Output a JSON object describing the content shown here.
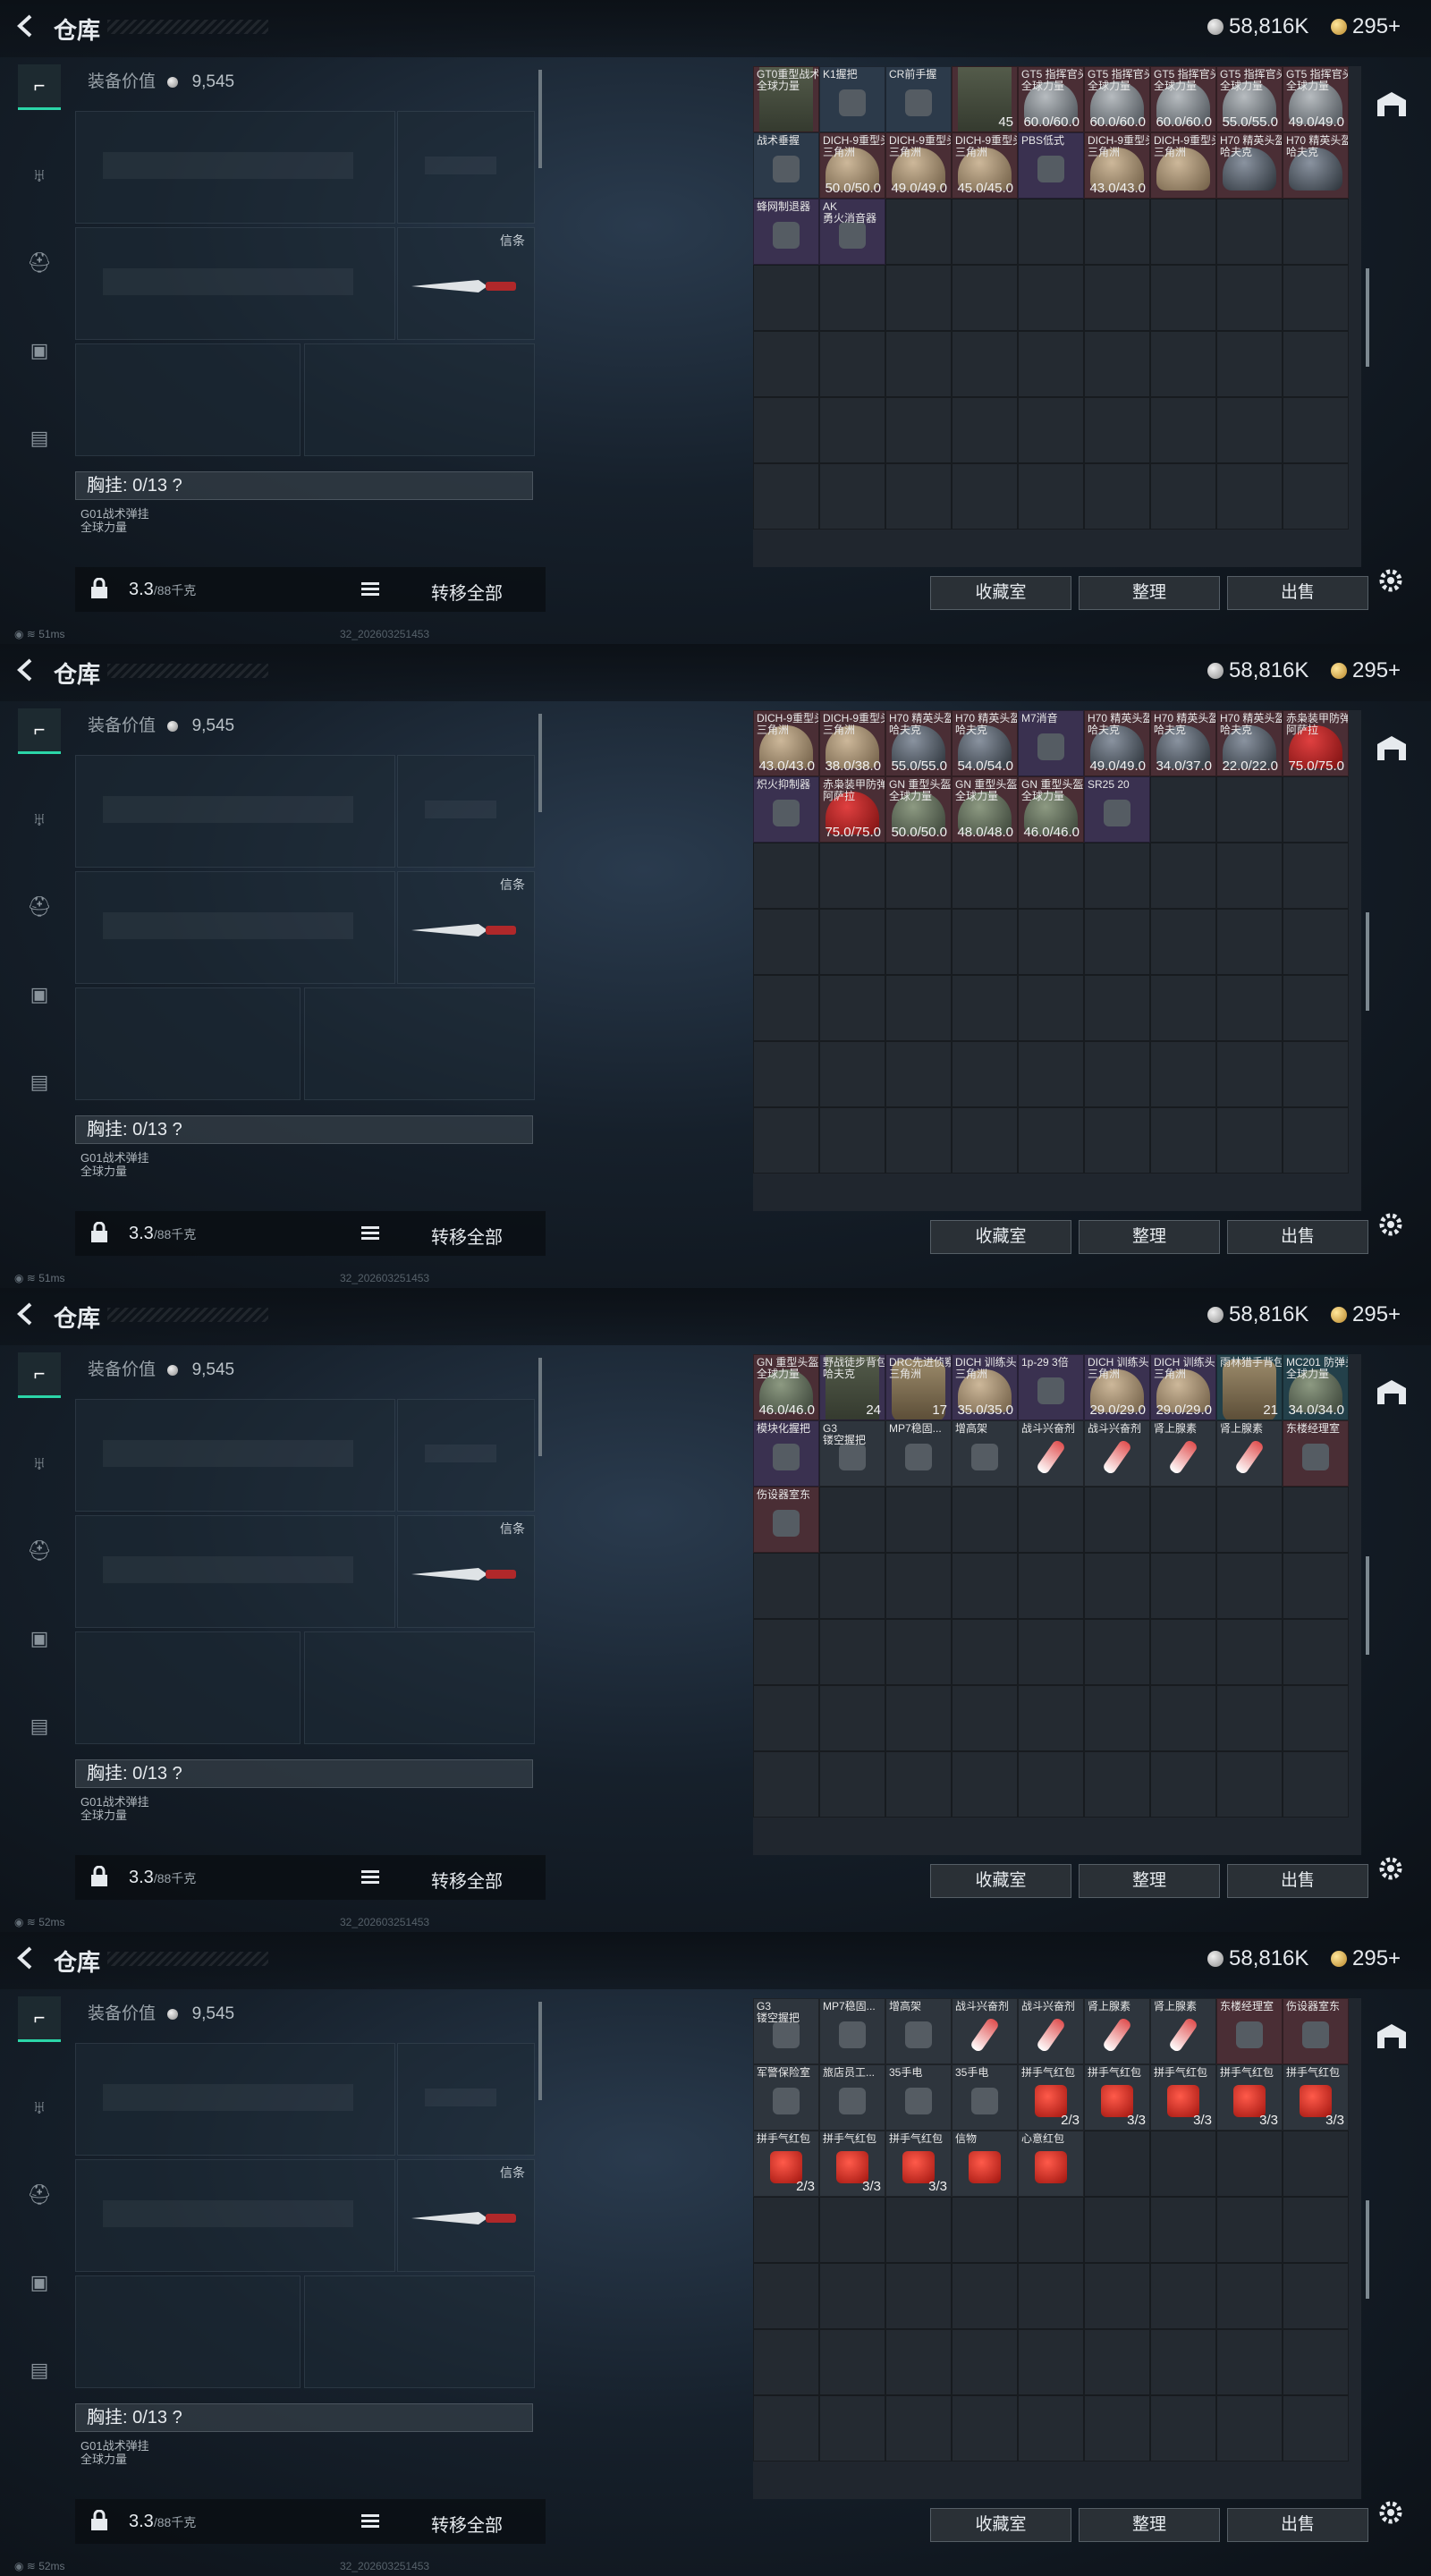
{
  "header": {
    "title": "仓库",
    "silver": "58,816K",
    "gold": "295+"
  },
  "loadout": {
    "equip_value_label": "装备价值",
    "equip_value": "9,545",
    "knife_label": "信条",
    "chest_label": "胸挂: 0/13 ?",
    "chest_item_line1": "G01战术弹挂",
    "chest_item_line2": "全球力量",
    "weight": "3.3",
    "weight_max": "/88千克",
    "transfer_label": "转移全部"
  },
  "stash_buttons": {
    "collection": "收藏室",
    "sort": "整理",
    "sell": "出售"
  },
  "status": [
    {
      "ping": "51ms",
      "build": "32_202603251453"
    },
    {
      "ping": "51ms",
      "build": "32_202603251453"
    },
    {
      "ping": "52ms",
      "build": "32_202603251453"
    },
    {
      "ping": "52ms",
      "build": "32_202603251453"
    }
  ],
  "panel1": [
    {
      "name": "GT0重型战术背",
      "sub": "全球力量",
      "val": "",
      "kind": "vest",
      "bg": "c-red"
    },
    {
      "name": "K1握把",
      "sub": "",
      "val": "",
      "kind": "small",
      "bg": "c-blue"
    },
    {
      "name": "CR前手握",
      "sub": "",
      "val": "",
      "kind": "small",
      "bg": "c-blue"
    },
    {
      "name": "",
      "sub": "",
      "val": "45",
      "kind": "vest",
      "bg": "c-red"
    },
    {
      "name": "GT5 指挥官头盔",
      "sub": "全球力量",
      "val": "60.0/60.0",
      "kind": "gray",
      "bg": "c-red"
    },
    {
      "name": "GT5 指挥官头盔",
      "sub": "全球力量",
      "val": "60.0/60.0",
      "kind": "gray",
      "bg": "c-red"
    },
    {
      "name": "GT5 指挥官头盔",
      "sub": "全球力量",
      "val": "60.0/60.0",
      "kind": "gray",
      "bg": "c-red"
    },
    {
      "name": "GT5 指挥官头盔",
      "sub": "全球力量",
      "val": "55.0/55.0",
      "kind": "gray",
      "bg": "c-red"
    },
    {
      "name": "GT5 指挥官头盔",
      "sub": "全球力量",
      "val": "49.0/49.0",
      "kind": "gray",
      "bg": "c-red"
    },
    {
      "name": "战术垂握",
      "sub": "",
      "val": "",
      "kind": "small",
      "bg": "c-blue"
    },
    {
      "name": "DICH-9重型头盔",
      "sub": "三角洲",
      "val": "50.0/50.0",
      "kind": "sand",
      "bg": "c-red"
    },
    {
      "name": "DICH-9重型头盔",
      "sub": "三角洲",
      "val": "49.0/49.0",
      "kind": "sand",
      "bg": "c-red"
    },
    {
      "name": "DICH-9重型头盔",
      "sub": "三角洲",
      "val": "45.0/45.0",
      "kind": "sand",
      "bg": "c-red"
    },
    {
      "name": "PBS低式",
      "sub": "",
      "val": "",
      "kind": "small",
      "bg": "c-purple"
    },
    {
      "name": "DICH-9重型头盔",
      "sub": "三角洲",
      "val": "43.0/43.0",
      "kind": "sand",
      "bg": "c-red"
    },
    {
      "name": "DICH-9重型头盔",
      "sub": "三角洲",
      "val": "",
      "kind": "sand",
      "bg": "c-red"
    },
    {
      "name": "H70 精英头盔",
      "sub": "哈夫克",
      "val": "",
      "kind": "dark",
      "bg": "c-red"
    },
    {
      "name": "H70 精英头盔",
      "sub": "哈夫克",
      "val": "",
      "kind": "dark",
      "bg": "c-red"
    },
    {
      "name": "蜂网制退器",
      "sub": "",
      "val": "",
      "kind": "small",
      "bg": "c-purple"
    },
    {
      "name": "AK",
      "sub": "勇火消音器",
      "val": "",
      "kind": "small",
      "bg": "c-purple"
    }
  ],
  "panel2": [
    {
      "name": "DICH-9重型头盔",
      "sub": "三角洲",
      "val": "43.0/43.0",
      "kind": "sand",
      "bg": "c-red"
    },
    {
      "name": "DICH-9重型头盔",
      "sub": "三角洲",
      "val": "38.0/38.0",
      "kind": "sand",
      "bg": "c-red"
    },
    {
      "name": "H70 精英头盔",
      "sub": "哈夫克",
      "val": "55.0/55.0",
      "kind": "dark",
      "bg": "c-red"
    },
    {
      "name": "H70 精英头盔",
      "sub": "哈夫克",
      "val": "54.0/54.0",
      "kind": "dark",
      "bg": "c-red"
    },
    {
      "name": "M7消音",
      "sub": "",
      "val": "",
      "kind": "small",
      "bg": "c-purple"
    },
    {
      "name": "H70 精英头盔",
      "sub": "哈夫克",
      "val": "49.0/49.0",
      "kind": "dark",
      "bg": "c-red"
    },
    {
      "name": "H70 精英头盔",
      "sub": "哈夫克",
      "val": "34.0/37.0",
      "kind": "dark",
      "bg": "c-red"
    },
    {
      "name": "H70 精英头盔",
      "sub": "哈夫克",
      "val": "22.0/22.0",
      "kind": "dark",
      "bg": "c-red"
    },
    {
      "name": "赤枭装甲防弹面具",
      "sub": "阿萨拉",
      "val": "75.0/75.0",
      "kind": "red",
      "bg": "c-red"
    },
    {
      "name": "炽火抑制器",
      "sub": "",
      "val": "",
      "kind": "small",
      "bg": "c-purple"
    },
    {
      "name": "赤枭装甲防弹面具",
      "sub": "阿萨拉",
      "val": "75.0/75.0",
      "kind": "red",
      "bg": "c-red"
    },
    {
      "name": "GN 重型头盔",
      "sub": "全球力量",
      "val": "50.0/50.0",
      "kind": "green",
      "bg": "c-red"
    },
    {
      "name": "GN 重型头盔",
      "sub": "全球力量",
      "val": "48.0/48.0",
      "kind": "green",
      "bg": "c-red"
    },
    {
      "name": "GN 重型头盔",
      "sub": "全球力量",
      "val": "46.0/46.0",
      "kind": "green",
      "bg": "c-red"
    },
    {
      "name": "SR25 20",
      "sub": "",
      "val": "",
      "kind": "small",
      "bg": "c-purple"
    }
  ],
  "panel3": [
    {
      "name": "GN 重型头盔",
      "sub": "全球力量",
      "val": "46.0/46.0",
      "kind": "green",
      "bg": "c-red"
    },
    {
      "name": "野战徒步背包",
      "sub": "哈夫克",
      "val": "24",
      "kind": "vest",
      "bg": "c-purple"
    },
    {
      "name": "DRC先进侦察胸挂",
      "sub": "三角洲",
      "val": "17",
      "kind": "bag",
      "bg": "c-purple"
    },
    {
      "name": "DICH 训练头盔",
      "sub": "三角洲",
      "val": "35.0/35.0",
      "kind": "sand",
      "bg": "c-purple"
    },
    {
      "name": "1p-29 3倍",
      "sub": "",
      "val": "",
      "kind": "small",
      "bg": "c-purple"
    },
    {
      "name": "DICH 训练头盔",
      "sub": "三角洲",
      "val": "29.0/29.0",
      "kind": "sand",
      "bg": "c-purple"
    },
    {
      "name": "DICH 训练头盔",
      "sub": "三角洲",
      "val": "29.0/29.0",
      "kind": "sand",
      "bg": "c-purple"
    },
    {
      "name": "雨林猎手背包",
      "sub": "",
      "val": "21",
      "kind": "bag",
      "bg": "c-teal"
    },
    {
      "name": "MC201 防弹头盔",
      "sub": "全球力量",
      "val": "34.0/34.0",
      "kind": "green",
      "bg": "c-teal"
    },
    {
      "name": "模块化握把",
      "sub": "",
      "val": "",
      "kind": "small",
      "bg": "c-purple"
    },
    {
      "name": "G3",
      "sub": "镂空握把",
      "val": "",
      "kind": "small",
      "bg": "c-gray"
    },
    {
      "name": "MP7稳固...",
      "sub": "",
      "val": "",
      "kind": "small",
      "bg": "c-gray"
    },
    {
      "name": "增高架",
      "sub": "",
      "val": "",
      "kind": "small",
      "bg": "c-gray"
    },
    {
      "name": "战斗兴奋剂",
      "sub": "",
      "val": "",
      "kind": "bottle",
      "bg": "c-gray"
    },
    {
      "name": "战斗兴奋剂",
      "sub": "",
      "val": "",
      "kind": "bottle",
      "bg": "c-gray"
    },
    {
      "name": "肾上腺素",
      "sub": "",
      "val": "",
      "kind": "bottle",
      "bg": "c-gray"
    },
    {
      "name": "肾上腺素",
      "sub": "",
      "val": "",
      "kind": "bottle",
      "bg": "c-gray"
    },
    {
      "name": "东楼经理室",
      "sub": "",
      "val": "",
      "kind": "small",
      "bg": "c-red"
    },
    {
      "name": "伤设器室东",
      "sub": "",
      "val": "",
      "kind": "small",
      "bg": "c-red"
    }
  ],
  "panel4": [
    {
      "name": "G3",
      "sub": "镂空握把",
      "val": "",
      "kind": "small",
      "bg": "c-gray"
    },
    {
      "name": "MP7稳固...",
      "sub": "",
      "val": "",
      "kind": "small",
      "bg": "c-gray"
    },
    {
      "name": "增高架",
      "sub": "",
      "val": "",
      "kind": "small",
      "bg": "c-gray"
    },
    {
      "name": "战斗兴奋剂",
      "sub": "",
      "val": "",
      "kind": "bottle",
      "bg": "c-gray"
    },
    {
      "name": "战斗兴奋剂",
      "sub": "",
      "val": "",
      "kind": "bottle",
      "bg": "c-gray"
    },
    {
      "name": "肾上腺素",
      "sub": "",
      "val": "",
      "kind": "bottle",
      "bg": "c-gray"
    },
    {
      "name": "肾上腺素",
      "sub": "",
      "val": "",
      "kind": "bottle",
      "bg": "c-gray"
    },
    {
      "name": "东楼经理室",
      "sub": "",
      "val": "",
      "kind": "small",
      "bg": "c-red"
    },
    {
      "name": "伤设器室东",
      "sub": "",
      "val": "",
      "kind": "small",
      "bg": "c-red"
    },
    {
      "name": "军警保险室",
      "sub": "",
      "val": "",
      "kind": "small",
      "bg": "c-gray"
    },
    {
      "name": "旅店员工...",
      "sub": "",
      "val": "",
      "kind": "small",
      "bg": "c-gray"
    },
    {
      "name": "35手电",
      "sub": "",
      "val": "",
      "kind": "small",
      "bg": "c-gray"
    },
    {
      "name": "35手电",
      "sub": "",
      "val": "",
      "kind": "small",
      "bg": "c-gray"
    },
    {
      "name": "拼手气红包",
      "sub": "",
      "val": "2/3",
      "kind": "redpack",
      "bg": "c-gray"
    },
    {
      "name": "拼手气红包",
      "sub": "",
      "val": "3/3",
      "kind": "redpack",
      "bg": "c-gray"
    },
    {
      "name": "拼手气红包",
      "sub": "",
      "val": "3/3",
      "kind": "redpack",
      "bg": "c-gray"
    },
    {
      "name": "拼手气红包",
      "sub": "",
      "val": "3/3",
      "kind": "redpack",
      "bg": "c-gray"
    },
    {
      "name": "拼手气红包",
      "sub": "",
      "val": "3/3",
      "kind": "redpack",
      "bg": "c-gray"
    },
    {
      "name": "拼手气红包",
      "sub": "",
      "val": "2/3",
      "kind": "redpack",
      "bg": "c-gray"
    },
    {
      "name": "拼手气红包",
      "sub": "",
      "val": "3/3",
      "kind": "redpack",
      "bg": "c-gray"
    },
    {
      "name": "拼手气红包",
      "sub": "",
      "val": "3/3",
      "kind": "redpack",
      "bg": "c-gray"
    },
    {
      "name": "信物",
      "sub": "",
      "val": "",
      "kind": "redpack",
      "bg": "c-gray"
    },
    {
      "name": "心意红包",
      "sub": "",
      "val": "",
      "kind": "redpack",
      "bg": "c-gray"
    }
  ]
}
